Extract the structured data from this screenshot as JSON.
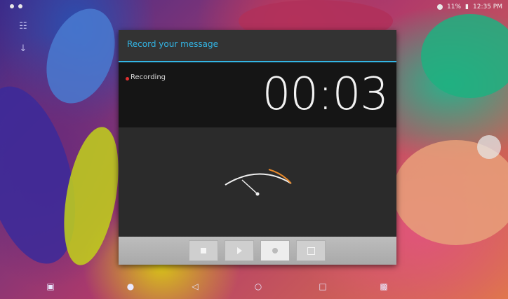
{
  "status_bar": {
    "time": "12:35 PM",
    "battery": "11%"
  },
  "dialog": {
    "title": "Record your message",
    "state_label": "Recording",
    "timer": "00:03",
    "accent_color": "#33b5e5",
    "controls": [
      {
        "name": "stop",
        "icon": "stop-icon"
      },
      {
        "name": "play",
        "icon": "play-icon"
      },
      {
        "name": "record",
        "icon": "record-icon",
        "active": true
      },
      {
        "name": "list",
        "icon": "list-icon"
      }
    ]
  },
  "navigation_bar": {
    "icons": [
      "screenshot-icon",
      "volume-down-icon",
      "back-icon",
      "home-icon",
      "recent-apps-icon",
      "volume-up-icon"
    ]
  }
}
